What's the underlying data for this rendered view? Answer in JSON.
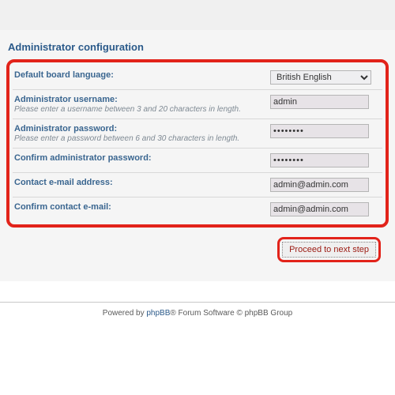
{
  "section_title": "Administrator configuration",
  "fields": {
    "language": {
      "label": "Default board language:",
      "value": "British English"
    },
    "username": {
      "label": "Administrator username:",
      "hint": "Please enter a username between 3 and 20 characters in length.",
      "value": "admin"
    },
    "password": {
      "label": "Administrator password:",
      "hint": "Please enter a password between 6 and 30 characters in length.",
      "value": "••••••••"
    },
    "confirm_password": {
      "label": "Confirm administrator password:",
      "value": "••••••••"
    },
    "email": {
      "label": "Contact e-mail address:",
      "value": "admin@admin.com"
    },
    "confirm_email": {
      "label": "Confirm contact e-mail:",
      "value": "admin@admin.com"
    }
  },
  "button": {
    "proceed": "Proceed to next step"
  },
  "footer": {
    "prefix": "Powered by ",
    "link": "phpBB",
    "suffix": "® Forum Software © phpBB Group"
  }
}
